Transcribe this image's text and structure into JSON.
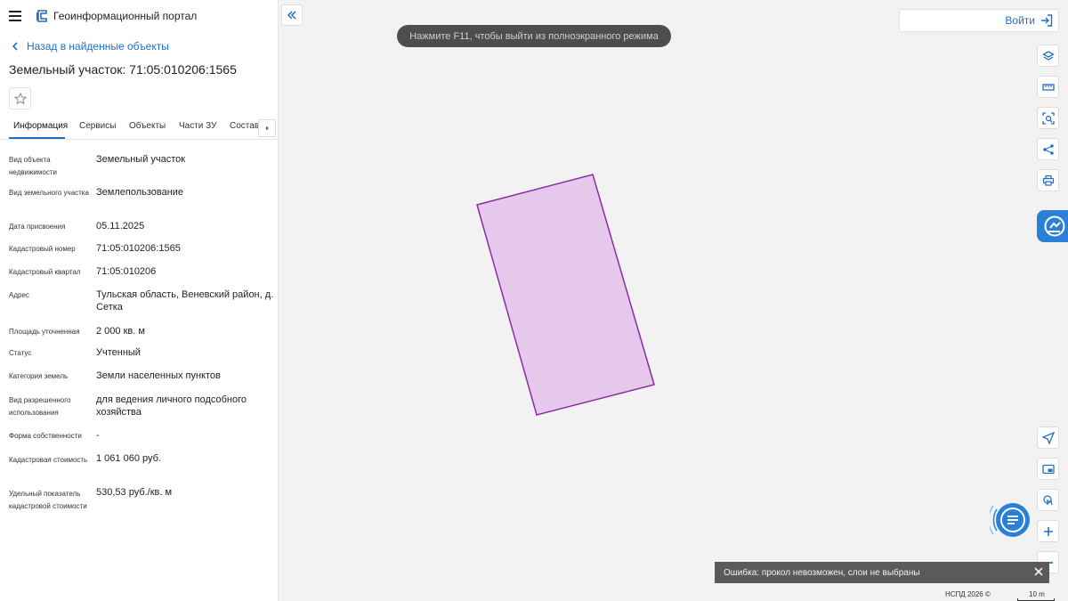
{
  "header": {
    "portal_title": "Геоинформационный портал"
  },
  "back_link": "Назад в найденные объекты",
  "page_title": "Земельный участок: 71:05:010206:1565",
  "tabs": [
    {
      "label": "Информация"
    },
    {
      "label": "Сервисы"
    },
    {
      "label": "Объекты"
    },
    {
      "label": "Части ЗУ"
    },
    {
      "label": "Состав"
    }
  ],
  "properties": [
    {
      "label": "Вид объекта недвижимости",
      "value": "Земельный участок"
    },
    {
      "label": "Вид земельного участка",
      "value": "Землепользование"
    },
    {
      "label": "Дата присвоения",
      "value": "05.11.2025"
    },
    {
      "label": "Кадастровый номер",
      "value": "71:05:010206:1565"
    },
    {
      "label": "Кадастровый квартал",
      "value": "71:05:010206"
    },
    {
      "label": "Адрес",
      "value": "Тульская область, Веневский район, д. Сетка"
    },
    {
      "label": "Площадь уточненная",
      "value": "2 000 кв. м"
    },
    {
      "label": "Статус",
      "value": "Учтенный"
    },
    {
      "label": "Категория земель",
      "value": "Земли населенных пунктов"
    },
    {
      "label": "Вид разрешенного использования",
      "value": "для ведения личного подсобного хозяйства"
    },
    {
      "label": "Форма собственности",
      "value": "-"
    },
    {
      "label": "Кадастровая стоимость",
      "value": "1 061 060 руб."
    },
    {
      "label": "Удельный показатель кадастровой стоимости",
      "value": "530,53 руб./кв. м"
    }
  ],
  "map": {
    "fullscreen_hint": "Нажмите F11, чтобы выйти из полноэкранного режима",
    "login_label": "Войти",
    "error_message": "Ошибка: прокол невозможен, слои не выбраны",
    "attribution": "НСПД 2026 ©",
    "scale_label": "10 m",
    "parcel_fill": "#e6c8ec",
    "parcel_stroke": "#8e2aa8"
  },
  "colors": {
    "accent": "#1f6fc5",
    "badge": "#2a80d8"
  },
  "icons": {
    "menu": "hamburger-icon",
    "logo": "portal-logo-icon",
    "back": "chevron-left-icon",
    "favorite": "star-icon",
    "tab_next": "chevron-right-icon",
    "collapse": "double-chevron-left-icon",
    "login": "login-icon",
    "tools": [
      "layers-icon",
      "ruler-icon",
      "area-select-icon",
      "share-icon",
      "print-icon"
    ],
    "bottom_tools": [
      "navigate-icon",
      "minimap-icon",
      "touch-icon",
      "zoom-in-icon",
      "zoom-out-icon"
    ],
    "chat": "chat-icon",
    "close": "close-icon"
  }
}
